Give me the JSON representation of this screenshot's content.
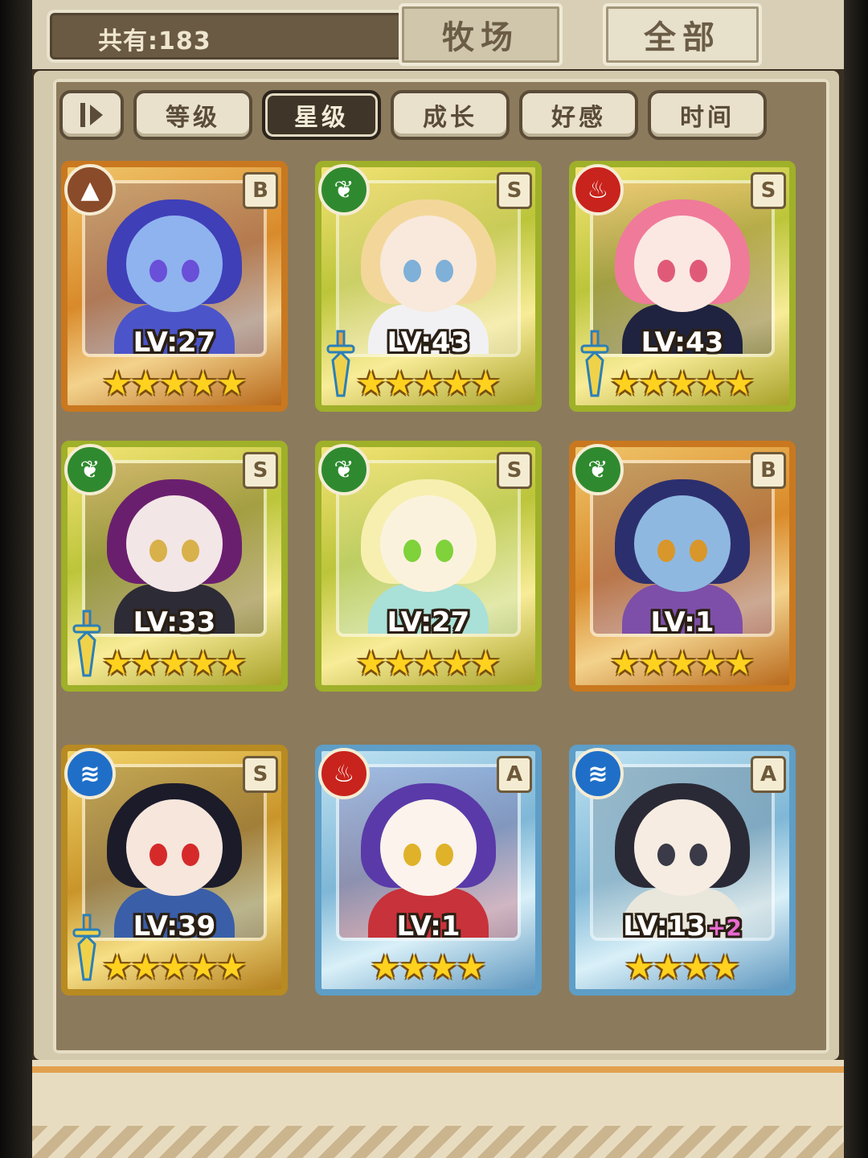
{
  "header": {
    "count_text": "共有:183",
    "tabs": [
      {
        "label": "牧场",
        "active": false
      },
      {
        "label": "全部",
        "active": true
      }
    ]
  },
  "sort_bar": {
    "order_icon": "sort-order-icon",
    "buttons": [
      {
        "label": "等级",
        "active": false
      },
      {
        "label": "星级",
        "active": true
      },
      {
        "label": "成长",
        "active": false
      },
      {
        "label": "好感",
        "active": false
      },
      {
        "label": "时间",
        "active": false
      }
    ]
  },
  "cards": [
    {
      "level": "LV:27",
      "rank": "B",
      "element": "earth-element-icon",
      "stars": 5,
      "frame": "orange",
      "equipped": false,
      "palette": {
        "hair": "#3f3fb8",
        "skin": "#8fb3ef",
        "body": "#4b55c9",
        "eye": "#6a4fd8"
      }
    },
    {
      "level": "LV:43",
      "rank": "S",
      "element": "nature-element-icon",
      "stars": 5,
      "frame": "green",
      "equipped": true,
      "palette": {
        "hair": "#f3d79a",
        "skin": "#f8e9dc",
        "body": "#f1f1f4",
        "eye": "#7fb0d8"
      }
    },
    {
      "level": "LV:43",
      "rank": "S",
      "element": "fire-element-icon",
      "stars": 5,
      "frame": "green",
      "equipped": true,
      "palette": {
        "hair": "#f07a9a",
        "skin": "#fbe8e2",
        "body": "#1f2340",
        "eye": "#e05a78"
      }
    },
    {
      "level": "LV:33",
      "rank": "S",
      "element": "nature-element-icon",
      "stars": 5,
      "frame": "green",
      "equipped": true,
      "palette": {
        "hair": "#6a1f6e",
        "skin": "#f3e6e6",
        "body": "#2d2b36",
        "eye": "#d8b14a"
      }
    },
    {
      "level": "LV:27",
      "rank": "S",
      "element": "nature-element-icon",
      "stars": 5,
      "frame": "green",
      "equipped": false,
      "palette": {
        "hair": "#f7efb0",
        "skin": "#fbf2de",
        "body": "#a9e0d8",
        "eye": "#7fd23a"
      }
    },
    {
      "level": "LV:1",
      "rank": "B",
      "element": "nature-element-icon",
      "stars": 5,
      "frame": "orange",
      "equipped": false,
      "palette": {
        "hair": "#2c2f6e",
        "skin": "#8fb8e0",
        "body": "#7d4fa8",
        "eye": "#d9962a"
      }
    },
    {
      "level": "LV:39",
      "rank": "S",
      "element": "water-element-icon",
      "stars": 5,
      "frame": "gold",
      "equipped": true,
      "palette": {
        "hair": "#1b1b2a",
        "skin": "#f6e6dc",
        "body": "#3a5fa8",
        "eye": "#d62a2a"
      }
    },
    {
      "level": "LV:1",
      "rank": "A",
      "element": "fire-element-icon",
      "stars": 4,
      "frame": "blue",
      "equipped": false,
      "palette": {
        "hair": "#5a3aa8",
        "skin": "#fbf3ec",
        "body": "#c8323a",
        "eye": "#e0b22a"
      }
    },
    {
      "level": "LV:13",
      "level_bonus": "+2",
      "rank": "A",
      "element": "water-element-icon",
      "stars": 4,
      "frame": "blue",
      "equipped": false,
      "palette": {
        "hair": "#2a2a36",
        "skin": "#f6ece2",
        "body": "#e9e6dc",
        "eye": "#3a3a48"
      }
    }
  ]
}
